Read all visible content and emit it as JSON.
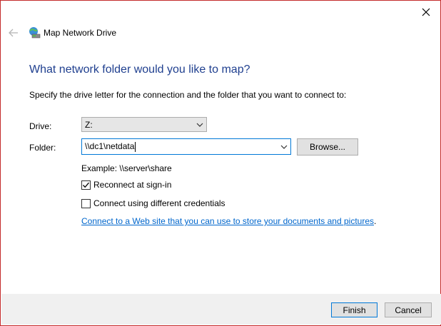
{
  "window": {
    "title": "Map Network Drive"
  },
  "heading": "What network folder would you like to map?",
  "instructions": "Specify the drive letter for the connection and the folder that you want to connect to:",
  "drive": {
    "label": "Drive:",
    "value": "Z:"
  },
  "folder": {
    "label": "Folder:",
    "value": "\\\\dc1\\netdata"
  },
  "browse_button": "Browse...",
  "example": "Example: \\\\server\\share",
  "reconnect": {
    "label": "Reconnect at sign-in",
    "checked": true
  },
  "credentials": {
    "label": "Connect using different credentials",
    "checked": false
  },
  "web_link": {
    "text": "Connect to a Web site that you can use to store your documents and pictures",
    "suffix": "."
  },
  "footer": {
    "finish": "Finish",
    "cancel": "Cancel"
  },
  "icons": {
    "close": "close-icon",
    "back": "back-arrow-icon",
    "app": "network-drive-icon",
    "dropdown": "chevron-down-icon",
    "check": "check-icon"
  },
  "colors": {
    "heading": "#1f3f8f",
    "link": "#0066cc",
    "focus": "#0078d7",
    "window_border": "#c42b2b"
  }
}
